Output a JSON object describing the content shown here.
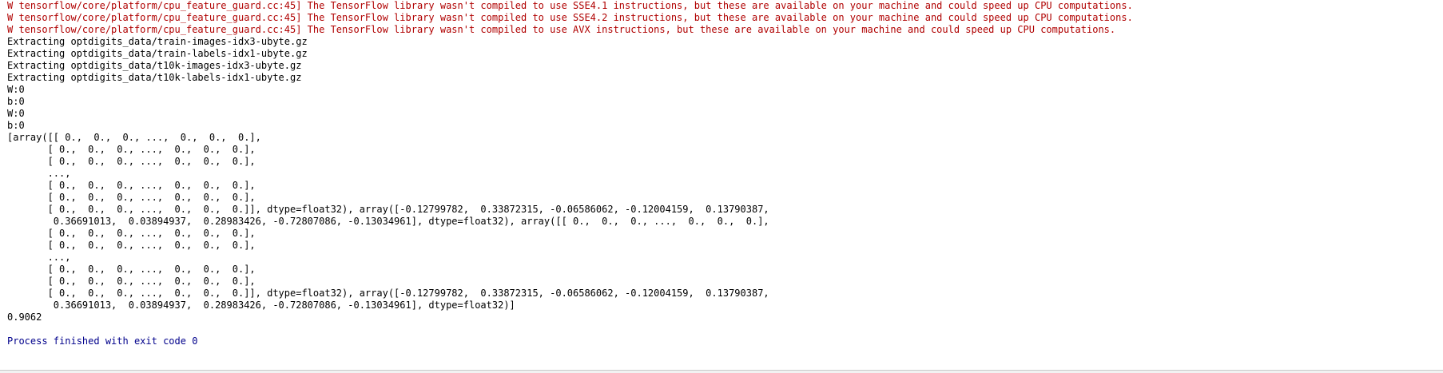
{
  "console": {
    "colors": {
      "warning": "#b00000",
      "stdout": "#000000",
      "exit": "#00008b",
      "background": "#ffffff"
    },
    "lines": [
      {
        "kind": "warning",
        "text": "W tensorflow/core/platform/cpu_feature_guard.cc:45] The TensorFlow library wasn't compiled to use SSE4.1 instructions, but these are available on your machine and could speed up CPU computations."
      },
      {
        "kind": "warning",
        "text": "W tensorflow/core/platform/cpu_feature_guard.cc:45] The TensorFlow library wasn't compiled to use SSE4.2 instructions, but these are available on your machine and could speed up CPU computations."
      },
      {
        "kind": "warning",
        "text": "W tensorflow/core/platform/cpu_feature_guard.cc:45] The TensorFlow library wasn't compiled to use AVX instructions, but these are available on your machine and could speed up CPU computations."
      },
      {
        "kind": "stdout",
        "text": "Extracting optdigits_data/train-images-idx3-ubyte.gz"
      },
      {
        "kind": "stdout",
        "text": "Extracting optdigits_data/train-labels-idx1-ubyte.gz"
      },
      {
        "kind": "stdout",
        "text": "Extracting optdigits_data/t10k-images-idx3-ubyte.gz"
      },
      {
        "kind": "stdout",
        "text": "Extracting optdigits_data/t10k-labels-idx1-ubyte.gz"
      },
      {
        "kind": "stdout",
        "text": "W:0"
      },
      {
        "kind": "stdout",
        "text": "b:0"
      },
      {
        "kind": "stdout",
        "text": "W:0"
      },
      {
        "kind": "stdout",
        "text": "b:0"
      },
      {
        "kind": "stdout",
        "text": "[array([[ 0.,  0.,  0., ...,  0.,  0.,  0.],"
      },
      {
        "kind": "stdout",
        "text": "       [ 0.,  0.,  0., ...,  0.,  0.,  0.],"
      },
      {
        "kind": "stdout",
        "text": "       [ 0.,  0.,  0., ...,  0.,  0.,  0.],"
      },
      {
        "kind": "stdout",
        "text": "       ..., "
      },
      {
        "kind": "stdout",
        "text": "       [ 0.,  0.,  0., ...,  0.,  0.,  0.],"
      },
      {
        "kind": "stdout",
        "text": "       [ 0.,  0.,  0., ...,  0.,  0.,  0.],"
      },
      {
        "kind": "stdout",
        "text": "       [ 0.,  0.,  0., ...,  0.,  0.,  0.]], dtype=float32), array([-0.12799782,  0.33872315, -0.06586062, -0.12004159,  0.13790387,"
      },
      {
        "kind": "stdout",
        "text": "        0.36691013,  0.03894937,  0.28983426, -0.72807086, -0.13034961], dtype=float32), array([[ 0.,  0.,  0., ...,  0.,  0.,  0.],"
      },
      {
        "kind": "stdout",
        "text": "       [ 0.,  0.,  0., ...,  0.,  0.,  0.],"
      },
      {
        "kind": "stdout",
        "text": "       [ 0.,  0.,  0., ...,  0.,  0.,  0.],"
      },
      {
        "kind": "stdout",
        "text": "       ..., "
      },
      {
        "kind": "stdout",
        "text": "       [ 0.,  0.,  0., ...,  0.,  0.,  0.],"
      },
      {
        "kind": "stdout",
        "text": "       [ 0.,  0.,  0., ...,  0.,  0.,  0.],"
      },
      {
        "kind": "stdout",
        "text": "       [ 0.,  0.,  0., ...,  0.,  0.,  0.]], dtype=float32), array([-0.12799782,  0.33872315, -0.06586062, -0.12004159,  0.13790387,"
      },
      {
        "kind": "stdout",
        "text": "        0.36691013,  0.03894937,  0.28983426, -0.72807086, -0.13034961], dtype=float32)]"
      },
      {
        "kind": "stdout",
        "text": "0.9062"
      },
      {
        "kind": "blank",
        "text": ""
      },
      {
        "kind": "exit",
        "text": "Process finished with exit code 0"
      }
    ]
  }
}
